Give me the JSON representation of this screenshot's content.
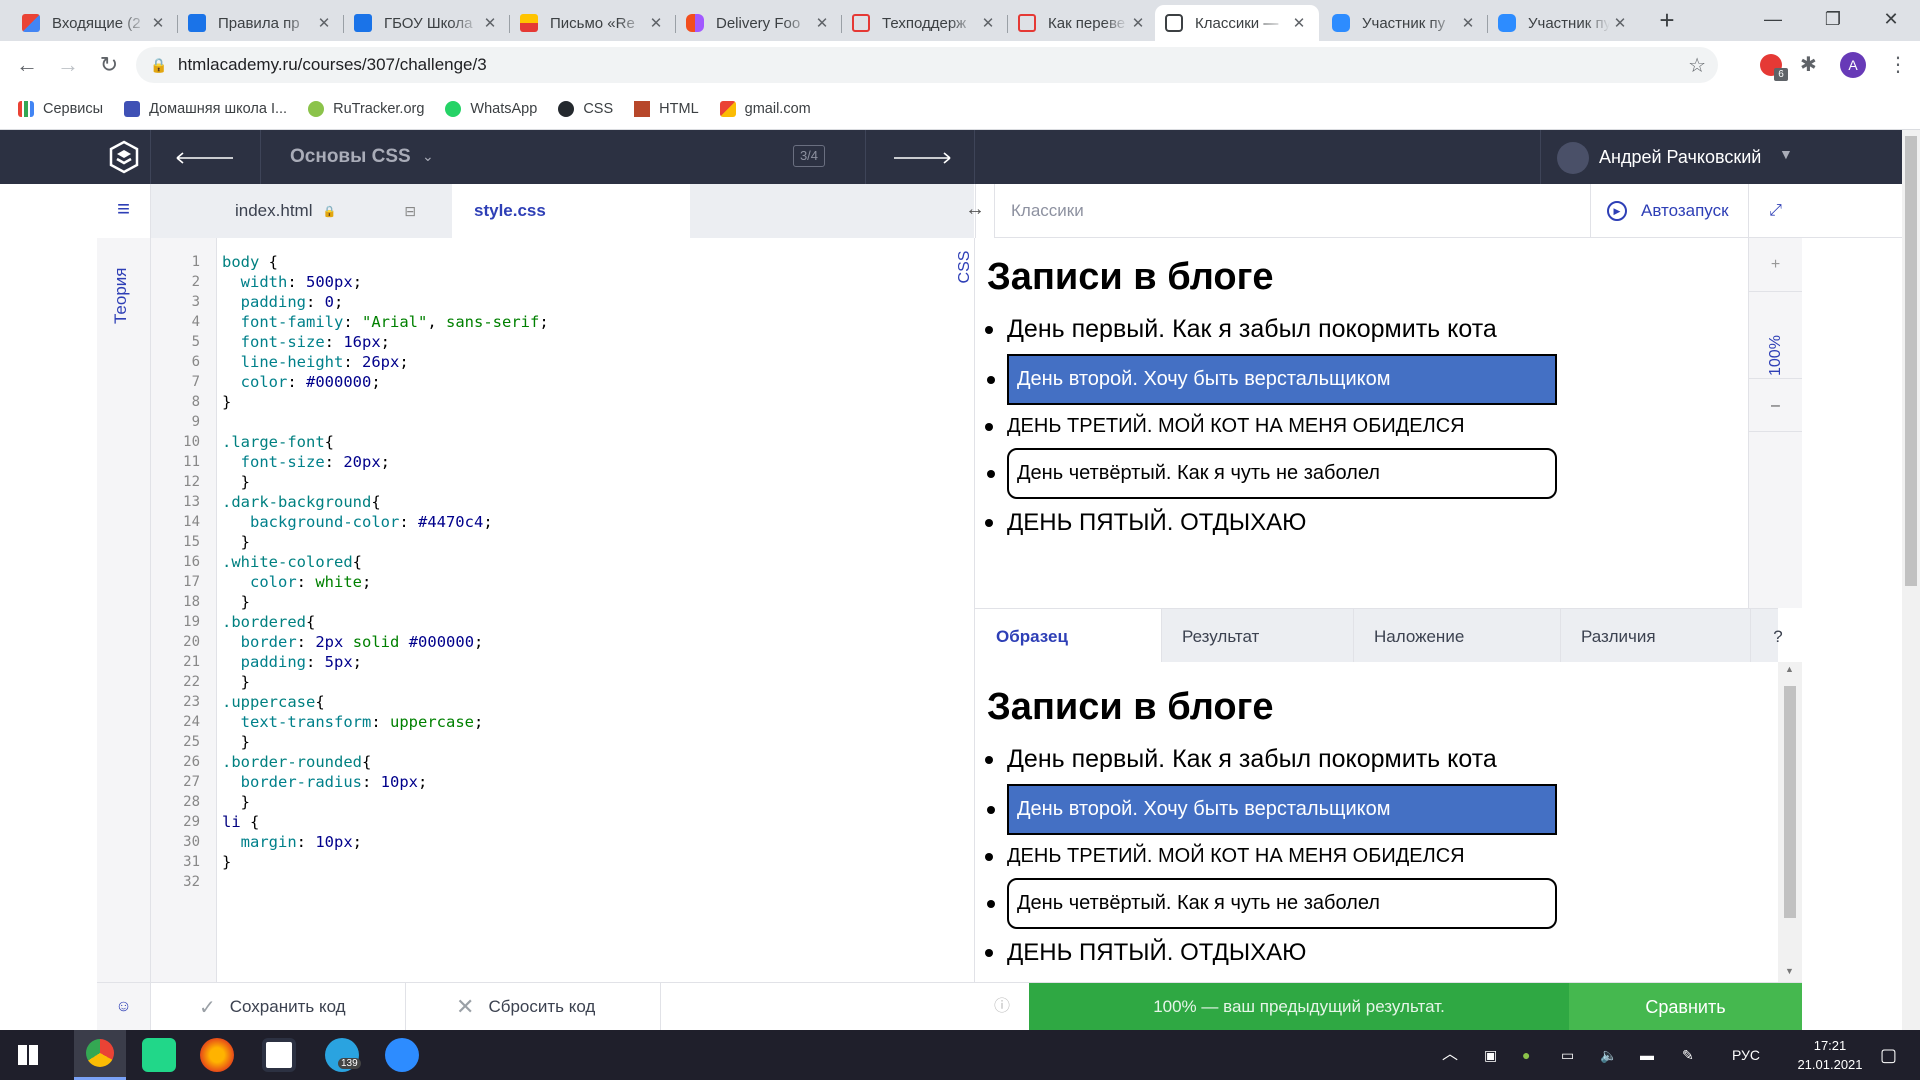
{
  "browser": {
    "tabs": [
      {
        "title": "Входящие (2"
      },
      {
        "title": "Правила пр"
      },
      {
        "title": "ГБОУ Школа"
      },
      {
        "title": "Письмо «Re"
      },
      {
        "title": "Delivery Foo"
      },
      {
        "title": "Техподдерж"
      },
      {
        "title": "Как переве"
      },
      {
        "title": "Классики —"
      },
      {
        "title": "Участник пу"
      },
      {
        "title": "Участник пу"
      }
    ],
    "url": "htmlacademy.ru/courses/307/challenge/3",
    "extension_badge": "6",
    "profile_initial": "A",
    "bookmarks": [
      {
        "label": "Сервисы"
      },
      {
        "label": "Домашняя школа I..."
      },
      {
        "label": "RuTracker.org"
      },
      {
        "label": "WhatsApp"
      },
      {
        "label": "CSS"
      },
      {
        "label": "HTML"
      },
      {
        "label": "gmail.com"
      }
    ]
  },
  "header": {
    "course": "Основы CSS",
    "progress": "3/4",
    "user": "Андрей Рачковский"
  },
  "sidebar": {
    "theory_label": "Теория"
  },
  "editor": {
    "tab_html": "index.html",
    "tab_css": "style.css",
    "lang_label": "CSS"
  },
  "preview": {
    "title": "Классики",
    "autorun": "Автозапуск",
    "zoom": "100%",
    "zoom_plus": "+",
    "zoom_minus": "–"
  },
  "page": {
    "heading": "Записи в блоге",
    "items": [
      "День первый. Как я забыл покормить кота",
      "День второй. Хочу быть верстальщиком",
      "День третий. Мой кот на меня обиделся",
      "День четвёртый. Как я чуть не заболел",
      "День пятый. Отдыхаю"
    ]
  },
  "compare": {
    "tabs": [
      "Образец",
      "Результат",
      "Наложение",
      "Различия"
    ],
    "help": "?"
  },
  "footer": {
    "save": "Сохранить код",
    "reset": "Сбросить код",
    "status": "100% — ваш предыдущий результат.",
    "compare_button": "Сравнить"
  },
  "taskbar": {
    "telegram_badge": "139",
    "lang": "РУС",
    "time": "17:21",
    "date": "21.01.2021"
  },
  "colors": {
    "header_bg": "#2c3142",
    "compare_green": "#3cb54a",
    "status_green": "#2fa843",
    "blue_item": "#4470c4"
  }
}
